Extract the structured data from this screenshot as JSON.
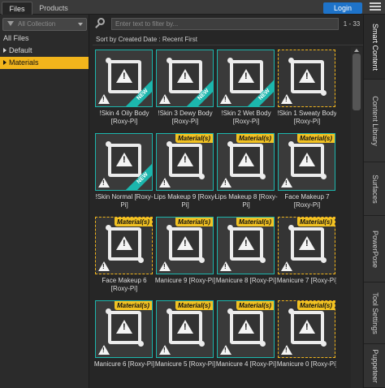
{
  "tabs": {
    "files": "Files",
    "products": "Products"
  },
  "header": {
    "login_label": "Login"
  },
  "tree": {
    "collection_label": "All Collection",
    "items": [
      {
        "label": "All Files"
      },
      {
        "label": "Default"
      },
      {
        "label": "Materials"
      }
    ]
  },
  "search": {
    "placeholder": "Enter text to filter by...",
    "range": "1 - 33"
  },
  "sort": {
    "label": "Sort by Created Date : Recent First"
  },
  "grid": {
    "badges": {
      "new": "NEW",
      "materials": "Material(s)"
    },
    "items": [
      {
        "label": "!Skin 4 Oily Body [Roxy-Pi]",
        "style": "new"
      },
      {
        "label": "!Skin 3 Dewy Body [Roxy-Pi]",
        "style": "new"
      },
      {
        "label": "!Skin 2 Wet Body [Roxy-Pi]",
        "style": "new"
      },
      {
        "label": "!Skin 1 Sweaty Body [Roxy-Pi]",
        "style": "dashed"
      },
      {
        "label": "!Skin Normal [Roxy-Pi]",
        "style": "new"
      },
      {
        "label": "Lips Makeup 9 [Roxy-Pi]",
        "style": "material"
      },
      {
        "label": "Lips Makeup 8 [Roxy-Pi]",
        "style": "material"
      },
      {
        "label": "Face Makeup 7 [Roxy-Pi]",
        "style": "material"
      },
      {
        "label": "Face Makeup 6 [Roxy-Pi]",
        "style": "material-dashed"
      },
      {
        "label": "Manicure 9 [Roxy-Pi]",
        "style": "material"
      },
      {
        "label": "Manicure 8 [Roxy-Pi]",
        "style": "material"
      },
      {
        "label": "Manicure 7 [Roxy-Pi]",
        "style": "material-dashed"
      },
      {
        "label": "Manicure 6 [Roxy-Pi]",
        "style": "material"
      },
      {
        "label": "Manicure 5 [Roxy-Pi]",
        "style": "material"
      },
      {
        "label": "Manicure 4 [Roxy-Pi]",
        "style": "material"
      },
      {
        "label": "Manicure 0 [Roxy-Pi]",
        "style": "material-dashed"
      }
    ]
  },
  "side_tabs": [
    {
      "label": "Smart Content",
      "active": true
    },
    {
      "label": "Content Library",
      "active": false
    },
    {
      "label": "Surfaces",
      "active": false
    },
    {
      "label": "PowerPose",
      "active": false
    },
    {
      "label": "Tool Settings",
      "active": false
    },
    {
      "label": "Puppeteer",
      "active": false
    }
  ],
  "colors": {
    "accent_teal": "#1cb6ad",
    "selection_yellow": "#f2b51c",
    "login_blue": "#1e73c9"
  }
}
